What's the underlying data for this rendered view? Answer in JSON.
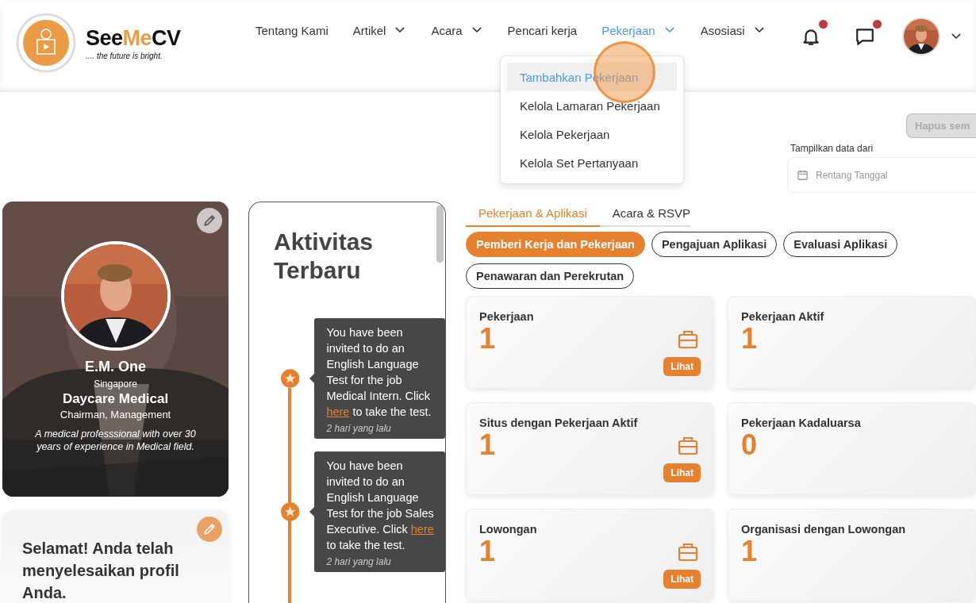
{
  "header": {
    "logo": {
      "wordmark": [
        "See",
        "Me",
        "CV"
      ],
      "tagline": ".... the future is bright."
    },
    "nav": [
      {
        "label": "Tentang Kami",
        "has_menu": false,
        "selected": false
      },
      {
        "label": "Artikel",
        "has_menu": true,
        "selected": false
      },
      {
        "label": "Acara",
        "has_menu": true,
        "selected": false
      },
      {
        "label": "Pencari kerja",
        "has_menu": false,
        "selected": false
      },
      {
        "label": "Pekerjaan",
        "has_menu": true,
        "selected": true
      },
      {
        "label": "Asosiasi",
        "has_menu": true,
        "selected": false
      }
    ],
    "alerts": [
      {
        "kind": "bell",
        "unread": true
      },
      {
        "kind": "chat",
        "unread": true
      }
    ]
  },
  "dropdown": {
    "items": [
      {
        "label": "Tambahkan Pekerjaan",
        "selected": true
      },
      {
        "label": "Kelola Lamaran Pekerjaan",
        "selected": false
      },
      {
        "label": "Kelola Pekerjaan",
        "selected": false
      },
      {
        "label": "Kelola Set Pertanyaan",
        "selected": false
      }
    ]
  },
  "toolbar": {
    "clear_button": {
      "label": "Hapus sem",
      "disabled": true
    },
    "date_filter": {
      "label": "Tampilkan data dari",
      "placeholder": "Rentang Tanggal"
    }
  },
  "profile": {
    "name": "E.M. One",
    "location": "Singapore",
    "company": "Daycare Medical",
    "position": "Chairman, Management",
    "bio": "A medical professsional with over 30 years of experience in Medical field."
  },
  "completion": {
    "message": "Selamat! Anda telah menyelesaikan profil Anda."
  },
  "activity": {
    "title": "Aktivitas Terbaru",
    "items": [
      {
        "before": "You have been invited to do an English Language Test for the job Medical Intern. Click ",
        "link": "here",
        "after": " to take the test.",
        "time": "2 hari yang lalu"
      },
      {
        "before": "You have been invited to do an English Language Test for the job Sales Executive. Click ",
        "link": "here",
        "after": " to take the test.",
        "time": "2 hari yang lalu"
      }
    ]
  },
  "dashboard": {
    "tabs": [
      {
        "label": "Pekerjaan & Aplikasi",
        "selected": true
      },
      {
        "label": "Acara & RSVP",
        "selected": false
      }
    ],
    "filters": [
      {
        "label": "Pemberi Kerja dan Pekerjaan",
        "selected": true
      },
      {
        "label": "Pengajuan Aplikasi",
        "selected": false
      },
      {
        "label": "Evaluasi Aplikasi",
        "selected": false
      },
      {
        "label": "Penawaran dan Perekrutan",
        "selected": false
      }
    ],
    "stats": [
      {
        "title": "Pekerjaan",
        "value": "1",
        "action": "Lihat"
      },
      {
        "title": "Pekerjaan Aktif",
        "value": "1"
      },
      {
        "title": "Situs dengan Pekerjaan Aktif",
        "value": "1",
        "action": "Lihat"
      },
      {
        "title": "Pekerjaan Kadaluarsa",
        "value": "0"
      },
      {
        "title": "Lowongan",
        "value": "1",
        "action": "Lihat"
      },
      {
        "title": "Organisasi dengan Lowongan",
        "value": "1"
      }
    ]
  }
}
